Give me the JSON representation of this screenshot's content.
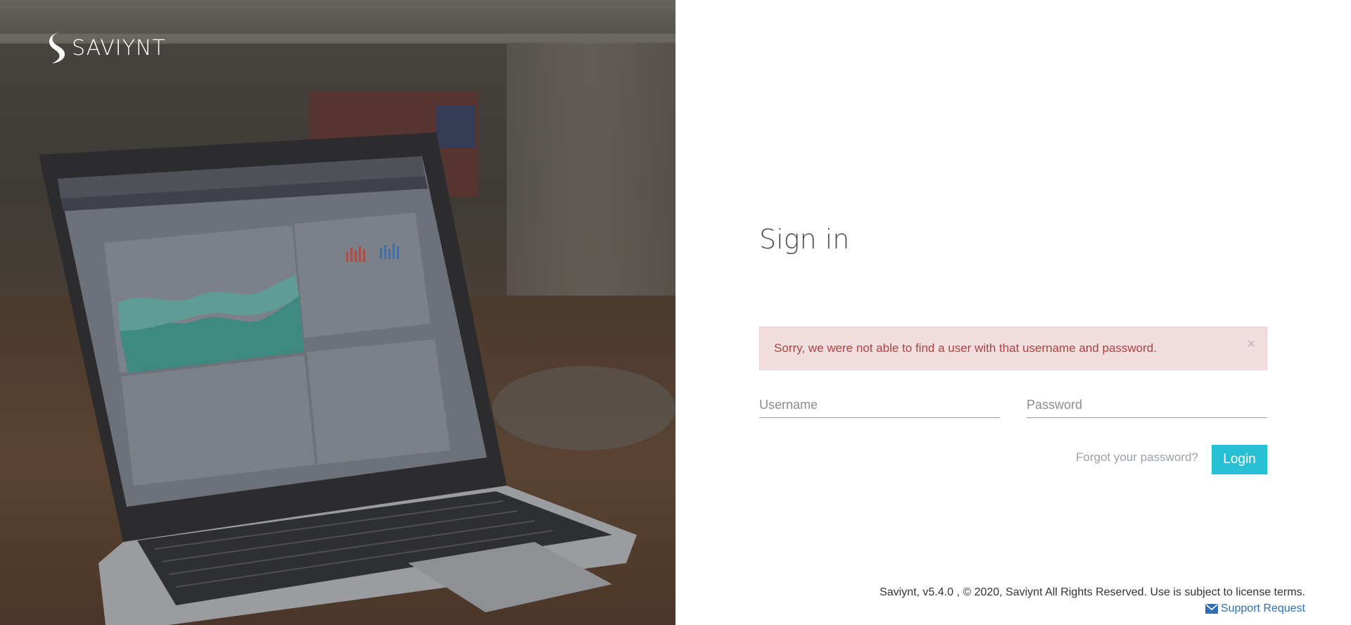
{
  "brand": {
    "logo_text": "SAVIYNT",
    "logo_icon": "saviynt-s-icon"
  },
  "signin": {
    "title": "Sign in",
    "error_message": "Sorry, we were not able to find a user with that username and password.",
    "close_symbol": "×",
    "username_placeholder": "Username",
    "username_value": "",
    "password_placeholder": "Password",
    "password_value": "",
    "forgot_label": "Forgot your password?",
    "login_label": "Login"
  },
  "footer": {
    "copyright": "Saviynt, v5.4.0 , © 2020, Saviynt All Rights Reserved. Use is subject to license terms.",
    "support_label": "Support Request",
    "support_icon": "envelope-icon"
  },
  "colors": {
    "accent": "#27bfd3",
    "error_bg": "#f2dede",
    "error_text": "#a94442",
    "link": "#2f6fb3"
  }
}
